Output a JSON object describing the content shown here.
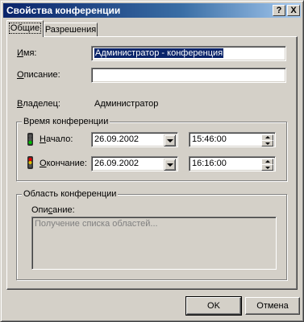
{
  "window": {
    "title": "Свойства конференции",
    "help_glyph": "?",
    "close_glyph": "X"
  },
  "tabs": [
    {
      "label": "Общие",
      "active": true
    },
    {
      "label": "Разрешения",
      "active": false
    }
  ],
  "form": {
    "name_label_u": "И",
    "name_label_rest": "мя:",
    "name_value": "Администратор - конференция",
    "desc_label_u": "О",
    "desc_label_rest": "писание:",
    "desc_value": "",
    "owner_label_u": "В",
    "owner_label_rest": "ладелец:",
    "owner_value": "Администратор"
  },
  "time_group": {
    "title": "Время конференции",
    "start_label_u": "Н",
    "start_label_rest": "ачало:",
    "start_date": "26.09.2002",
    "start_time": "15:46:00",
    "end_label_u": "О",
    "end_label_rest": "кончание:",
    "end_date": "26.09.2002",
    "end_time": "16:16:00"
  },
  "scope_group": {
    "title": "Область конференции",
    "desc_label_pre": "Опи",
    "desc_label_u": "с",
    "desc_label_post": "ание:",
    "placeholder": "Получение списка областей..."
  },
  "buttons": {
    "ok": "OK",
    "cancel": "Отмена"
  },
  "colors": {
    "title_start": "#0a246a",
    "title_end": "#a6caf0",
    "face": "#d4d0c8",
    "selection": "#0a246a",
    "traffic_green": "#00a000",
    "traffic_red": "#d00000",
    "traffic_yellow": "#e0c000"
  }
}
